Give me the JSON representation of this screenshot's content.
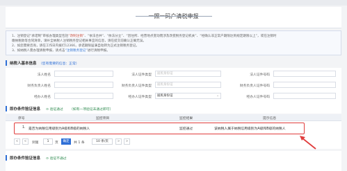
{
  "page_title": "一照一码户清税申报",
  "notice": {
    "line1_a": "1、注销登记“承诺制”审核办理类型包括",
    "line1_link": "“改制注销”",
    "line1_b": "、“依法合并”、“依法分立”、“因住所、经营地点变动而涉及改变税务登记机关”、“经确认非正常户期限达到规定期限以上”，或在注销时",
    "line2": "   缴纳税款等合同清单，请补全纳税人注销税务登记相关事宜的信息，请在提交前确认正确无误。",
    "line3": "2、如您需要咨询，请在工作日内拨打12366，承诺期限届满自动转为正式注销税务登记。",
    "line4_a": "3、如纳税人需办理清税申报，请点击",
    "line4_link": "“注销税务登记”",
    "line4_b": "进行清税申报。"
  },
  "basic_info": {
    "title": "纳税人基本信息",
    "hint": "（您有需要的信息：正常）",
    "row1": [
      {
        "label": "法人姓名",
        "value": "",
        "placeholder": ""
      },
      {
        "label": "法人证件类型",
        "value": "",
        "placeholder": "居民身份证"
      },
      {
        "label": "法人证件号码",
        "value": "",
        "placeholder": ""
      }
    ],
    "row2": [
      {
        "label": "财务负责人姓名",
        "value": "",
        "placeholder": ""
      },
      {
        "label": "财务负责人证件类型",
        "value": "",
        "placeholder": "居民身份证"
      },
      {
        "label": "财务负责人证件号码",
        "value": "",
        "placeholder": ""
      }
    ],
    "row3": [
      {
        "label": "经办人姓名",
        "value": "",
        "placeholder": ""
      },
      {
        "label": "经办人证件类型",
        "value": "居民身份证",
        "placeholder": ""
      },
      {
        "label": "经办人证件号码",
        "value": "",
        "placeholder": ""
      }
    ]
  },
  "verify_section": {
    "title": "即办条件验证信息",
    "status": "验证通过",
    "hint": "（如有一项验证未通过即可）"
  },
  "table": {
    "headers": [
      "序号",
      "监控项目",
      "监控结果",
      "提示信息"
    ],
    "rows": [
      {
        "index": "1.",
        "item": "是否为纳税信用级别为A级和B级的纳税人",
        "result": "监控通过",
        "info": "该纳税人属于纳税信用级别为A级和B级的纳税人"
      }
    ]
  },
  "pager": {
    "first": "<",
    "prev": "<",
    "goto_label": "到第",
    "page_value": "1",
    "page_suffix": "页",
    "confirm": "确定",
    "total": "共 1 条",
    "page_size": "10 条/页",
    "next": ">",
    "last": ">"
  },
  "bottom_section": {
    "title": "即办条件验证信息",
    "status": "验证不通过"
  },
  "colors": {
    "accent": "#2f6fd6",
    "highlight": "#e03c3c",
    "success": "#2e8a4f"
  }
}
